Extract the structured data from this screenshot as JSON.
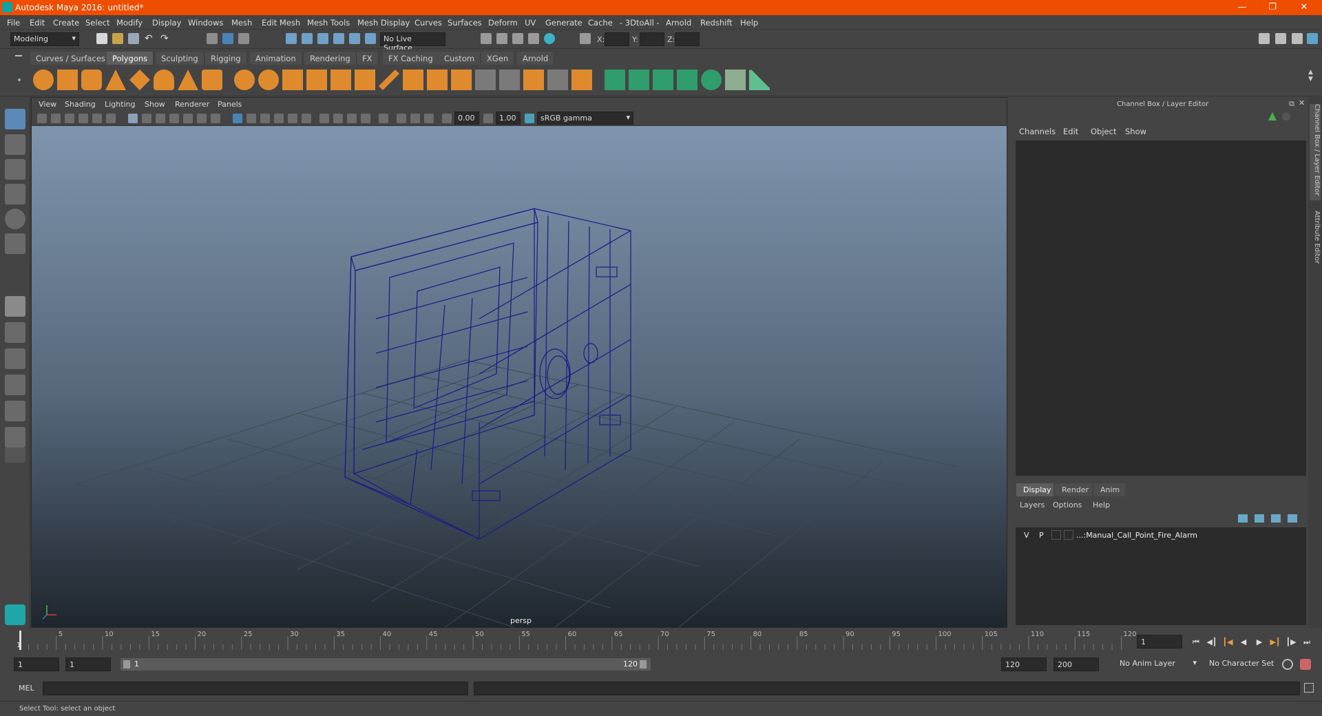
{
  "window": {
    "title": "Autodesk Maya 2016: untitled*"
  },
  "menubar": [
    "File",
    "Edit",
    "Create",
    "Select",
    "Modify",
    "Display",
    "Windows",
    "Mesh",
    "Edit Mesh",
    "Mesh Tools",
    "Mesh Display",
    "Curves",
    "Surfaces",
    "Deform",
    "UV",
    "Generate",
    "Cache",
    "- 3DtoAll -",
    "Arnold",
    "Redshift",
    "Help"
  ],
  "status": {
    "workspace": "Modeling",
    "live_surface": "No Live Surface",
    "x_label": "X:",
    "y_label": "Y:",
    "z_label": "Z:"
  },
  "shelf_tabs": [
    "Curves / Surfaces",
    "Polygons",
    "Sculpting",
    "Rigging",
    "Animation",
    "Rendering",
    "FX",
    "FX Caching",
    "Custom",
    "XGen",
    "Arnold"
  ],
  "shelf_active": "Polygons",
  "viewport": {
    "menu": [
      "View",
      "Shading",
      "Lighting",
      "Show",
      "Renderer",
      "Panels"
    ],
    "exposure": "0.00",
    "gamma": "1.00",
    "color_space": "sRGB gamma",
    "camera": "persp"
  },
  "channel_box": {
    "title": "Channel Box / Layer Editor",
    "menu": [
      "Channels",
      "Edit",
      "Object",
      "Show"
    ],
    "layer_tabs": [
      "Display",
      "Render",
      "Anim"
    ],
    "layer_active": "Display",
    "layer_menu": [
      "Layers",
      "Options",
      "Help"
    ],
    "layer": {
      "v": "V",
      "p": "P",
      "name": "...:Manual_Call_Point_Fire_Alarm"
    }
  },
  "side_tabs": [
    "Channel Box / Layer Editor",
    "Attribute Editor"
  ],
  "timeline": {
    "ticks": [
      "5",
      "10",
      "15",
      "20",
      "25",
      "30",
      "35",
      "40",
      "45",
      "50",
      "55",
      "60",
      "65",
      "70",
      "75",
      "80",
      "85",
      "90",
      "95",
      "100",
      "105",
      "110",
      "115",
      "120"
    ],
    "start_label": "1",
    "current_frame": "1"
  },
  "range": {
    "start": "1",
    "playback_start": "1",
    "slider_start": "1",
    "slider_end": "120",
    "playback_end": "120",
    "end": "200",
    "anim_layer": "No Anim Layer",
    "character_set": "No Character Set"
  },
  "command": {
    "label": "MEL"
  },
  "help_line": "Select Tool: select an object",
  "colors": {
    "title_bar": "#ef4d00",
    "wireframe": "#1a1a8a",
    "accent": "#0fa3a8"
  }
}
